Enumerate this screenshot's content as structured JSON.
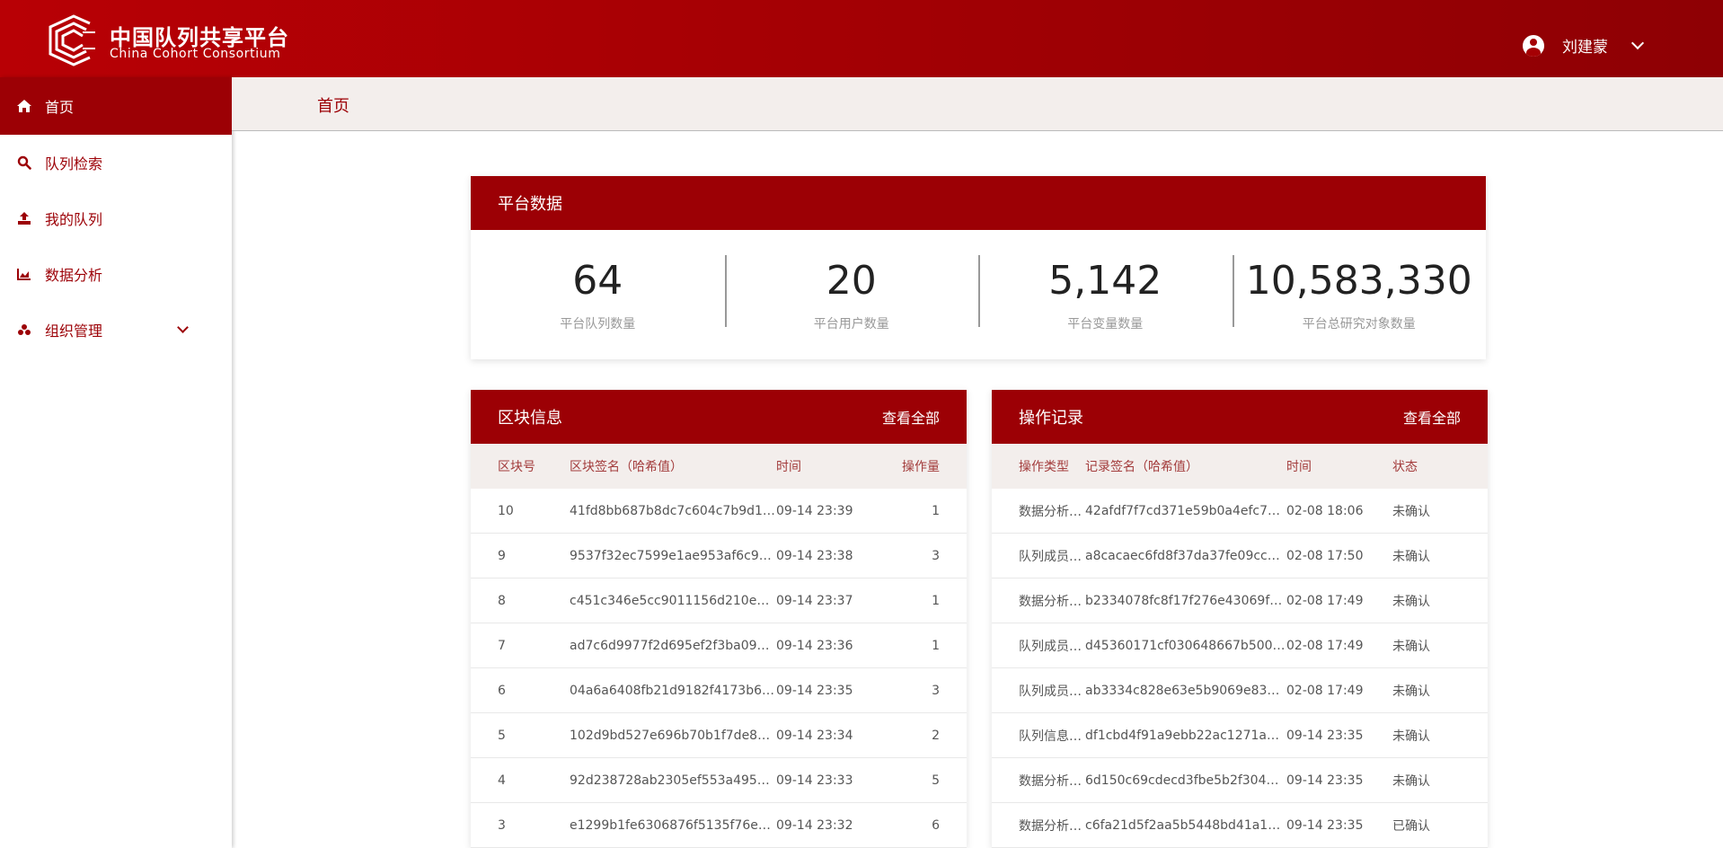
{
  "header": {
    "brand_cn": "中国队列共享平台",
    "brand_en": "China Cohort Consortium",
    "user_name": "刘建蒙"
  },
  "sidebar": {
    "items": [
      {
        "label": "首页",
        "icon": "home-icon",
        "active": true
      },
      {
        "label": "队列检索",
        "icon": "search-icon"
      },
      {
        "label": "我的队列",
        "icon": "upload-icon"
      },
      {
        "label": "数据分析",
        "icon": "chart-icon"
      },
      {
        "label": "组织管理",
        "icon": "org-icon",
        "expandable": true
      }
    ]
  },
  "breadcrumb": {
    "current": "首页"
  },
  "platform_stats": {
    "title": "平台数据",
    "items": [
      {
        "value": "64",
        "label": "平台队列数量"
      },
      {
        "value": "20",
        "label": "平台用户数量"
      },
      {
        "value": "5,142",
        "label": "平台变量数量"
      },
      {
        "value": "10,583,330",
        "label": "平台总研究对象数量"
      }
    ]
  },
  "blocks": {
    "title": "区块信息",
    "view_all": "查看全部",
    "columns": [
      "区块号",
      "区块签名（哈希值）",
      "时间",
      "操作量"
    ],
    "rows": [
      [
        "10",
        "41fd8bb687b8dc7c604c7b9d1…",
        "09-14 23:39",
        "1"
      ],
      [
        "9",
        "9537f32ec7599e1ae953af6c9…",
        "09-14 23:38",
        "3"
      ],
      [
        "8",
        "c451c346e5cc9011156d210eb…",
        "09-14 23:37",
        "1"
      ],
      [
        "7",
        "ad7c6d9977f2d695ef2f3ba09…",
        "09-14 23:36",
        "1"
      ],
      [
        "6",
        "04a6a6408fb21d9182f4173b6…",
        "09-14 23:35",
        "3"
      ],
      [
        "5",
        "102d9bd527e696b70b1f7de8…",
        "09-14 23:34",
        "2"
      ],
      [
        "4",
        "92d238728ab2305ef553a495…",
        "09-14 23:33",
        "5"
      ],
      [
        "3",
        "e1299b1fe6306876f5135f76e…",
        "09-14 23:32",
        "6"
      ]
    ]
  },
  "operations": {
    "title": "操作记录",
    "view_all": "查看全部",
    "columns": [
      "操作类型",
      "记录签名（哈希值）",
      "时间",
      "状态"
    ],
    "rows": [
      [
        "数据分析删除",
        "42afdf7f7cd371e59b0a4efc7a…",
        "02-08 18:06",
        "未确认"
      ],
      [
        "队列成员新增",
        "a8cacaec6fd8f37da37fe09cc…",
        "02-08 17:50",
        "未确认"
      ],
      [
        "数据分析删除",
        "b2334078fc8f17f276e43069f…",
        "02-08 17:49",
        "未确认"
      ],
      [
        "队列成员权…",
        "d45360171cf030648667b5001…",
        "02-08 17:49",
        "未确认"
      ],
      [
        "队列成员权…",
        "ab3334c828e63e5b9069e83…",
        "02-08 17:49",
        "未确认"
      ],
      [
        "队列信息更改",
        "df1cbd4f91a9ebb22ac1271a80…",
        "09-14 23:35",
        "未确认"
      ],
      [
        "数据分析更改",
        "6d150c69cdecd3fbe5b2f304…",
        "09-14 23:35",
        "未确认"
      ],
      [
        "数据分析导入",
        "c6fa21d5f2aa5b5448bd41a1d…",
        "09-14 23:35",
        "已确认"
      ]
    ]
  }
}
